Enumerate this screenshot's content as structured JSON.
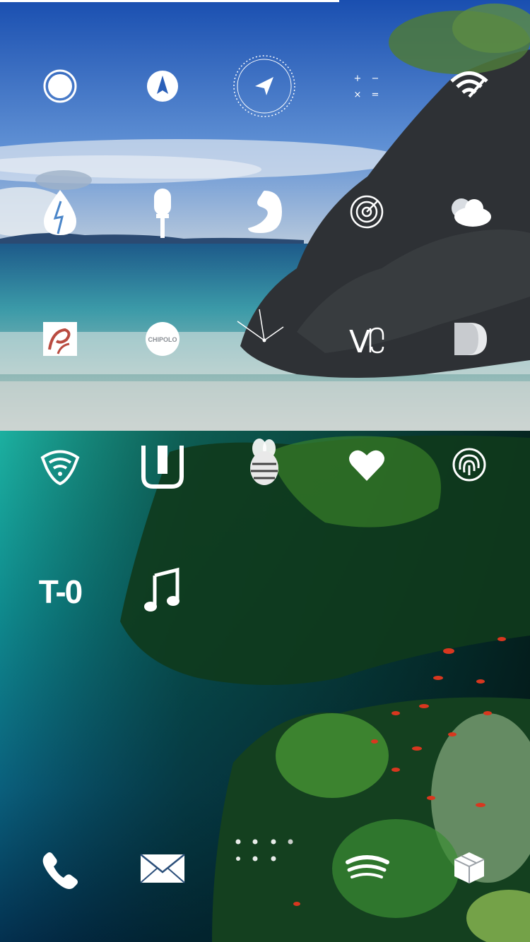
{
  "colors": {
    "sky_top": "#1d58b8",
    "sky_mid": "#5b8fd6",
    "cloud": "#dfe7ef",
    "horizon": "#1f3f6a",
    "shallow": "#3aa6a8",
    "surf": "#cfd8d6",
    "rock": "#2c2f32",
    "underwater_top": "#1aa79a",
    "underwater_deep": "#04385e",
    "reef": "#1e5f2a",
    "coral_red": "#d8371f",
    "icon": "#ffffff"
  },
  "apps": {
    "row1": [
      "circle-app-icon",
      "compass-arrow-icon",
      "navigation-dial-icon",
      "calculator-icon",
      "wifi-speed-icon"
    ],
    "row2": [
      "droplet-icon",
      "microphone-icon",
      "shazam-icon",
      "radar-icon",
      "weather-cloud-icon"
    ],
    "row3": [
      "chick-fil-a-icon",
      "chipolo-icon",
      "clock-icon",
      "vine-icon",
      "d-app-icon"
    ],
    "row4": [
      "shield-wifi-icon",
      "uber-icon",
      "bee-icon",
      "heart-icon",
      "fingerprint-icon"
    ],
    "row5": [
      "countdown-icon",
      "music-note-icon"
    ],
    "dock": [
      "phone-icon",
      "mail-icon",
      "folder-dots-icon",
      "spotify-icon",
      "cydia-box-icon"
    ]
  },
  "labels": {
    "chipolo": "CHIPOLO",
    "countdown": "T-0",
    "vine_letter": "V",
    "calc_ops": [
      "+",
      "−",
      "×",
      "="
    ]
  }
}
